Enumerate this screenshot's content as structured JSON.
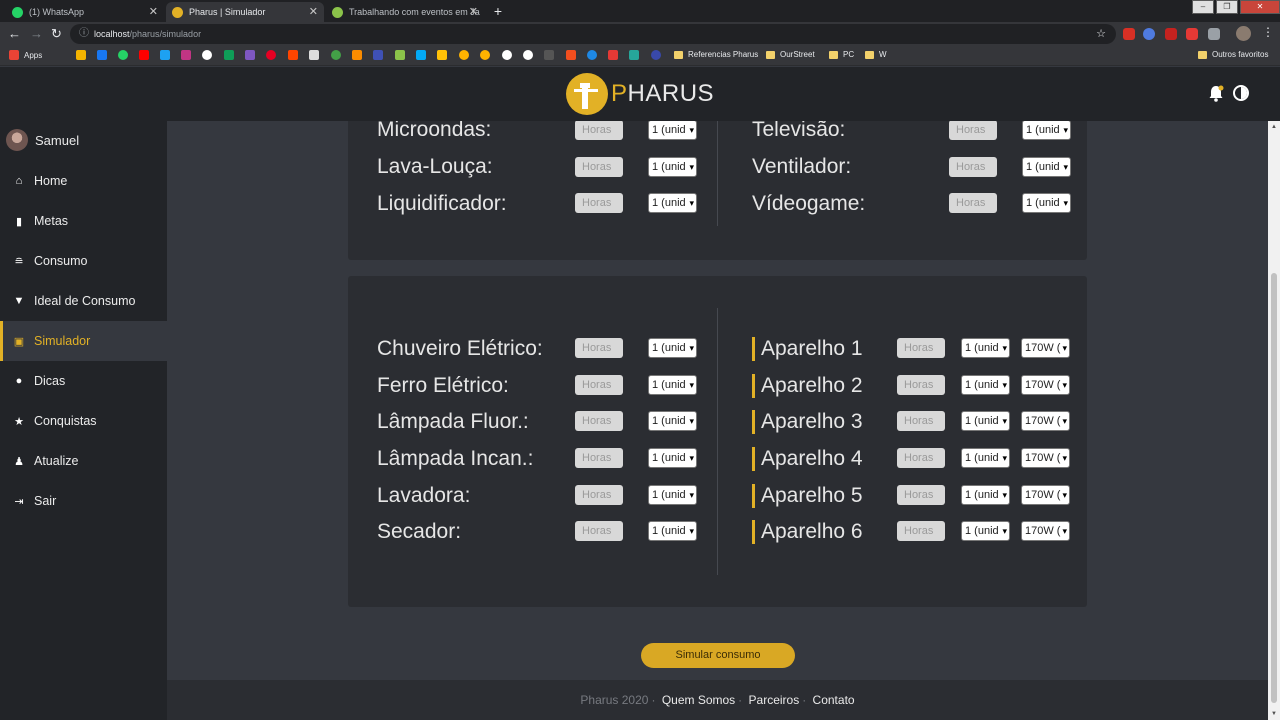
{
  "browser": {
    "tabs": [
      {
        "title": "(1) WhatsApp",
        "color": "#25d366"
      },
      {
        "title": "Pharus | Simulador",
        "color": "#e2b126"
      },
      {
        "title": "Trabalhando com eventos em Ja",
        "color": "#8bc34a"
      }
    ],
    "url_host": "localhost",
    "url_path": "/pharus/simulador",
    "bookmarks": {
      "apps": "Apps",
      "folders": [
        "Referencias Pharus",
        "OurStreet",
        "PC",
        "W"
      ],
      "other": "Outros favoritos"
    }
  },
  "app": {
    "brand_first": "P",
    "brand_rest": "HARUS",
    "accent": "#e2b126"
  },
  "sidebar": {
    "user": "Samuel",
    "items": [
      {
        "label": "Home",
        "icon": "home-icon"
      },
      {
        "label": "Metas",
        "icon": "bookmark-icon"
      },
      {
        "label": "Consumo",
        "icon": "coins-icon"
      },
      {
        "label": "Ideal de Consumo",
        "icon": "funnel-dollar-icon"
      },
      {
        "label": "Simulador",
        "icon": "laptop-icon"
      },
      {
        "label": "Dicas",
        "icon": "lightbulb-icon"
      },
      {
        "label": "Conquistas",
        "icon": "star-icon"
      },
      {
        "label": "Atualize",
        "icon": "user-ninja-icon"
      },
      {
        "label": "Sair",
        "icon": "sign-out-icon"
      }
    ],
    "active": "Simulador"
  },
  "simulator": {
    "hours_placeholder": "Horas",
    "qty_value": "1 (unid",
    "power_value": "170W (",
    "card1_left": [
      "Microondas:",
      "Lava-Louça:",
      "Liquidificador:"
    ],
    "card1_right": [
      "Televisão:",
      "Ventilador:",
      "Vídeogame:"
    ],
    "card2_left": [
      "Chuveiro Elétrico:",
      "Ferro Elétrico:",
      "Lâmpada Fluor.:",
      "Lâmpada Incan.:",
      "Lavadora:",
      "Secador:"
    ],
    "card2_right": [
      "Aparelho 1",
      "Aparelho 2",
      "Aparelho 3",
      "Aparelho 4",
      "Aparelho 5",
      "Aparelho 6"
    ],
    "submit": "Simular consumo"
  },
  "footer": {
    "copyright": "Pharus 2020",
    "links": [
      "Quem Somos",
      "Parceiros",
      "Contato"
    ]
  }
}
